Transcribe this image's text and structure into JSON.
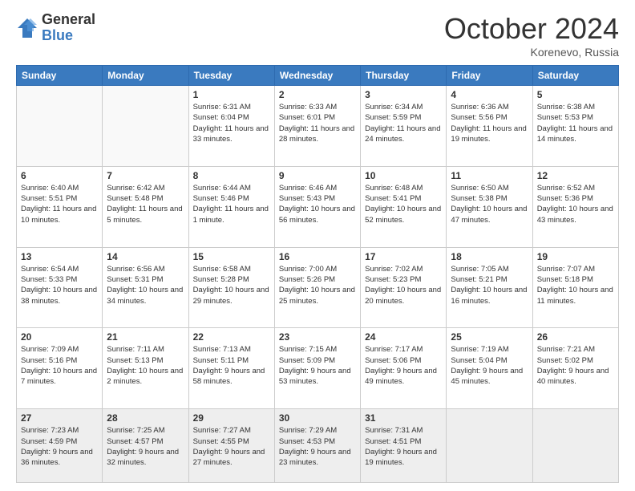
{
  "logo": {
    "general": "General",
    "blue": "Blue"
  },
  "header": {
    "month": "October 2024",
    "location": "Korenevo, Russia"
  },
  "days_of_week": [
    "Sunday",
    "Monday",
    "Tuesday",
    "Wednesday",
    "Thursday",
    "Friday",
    "Saturday"
  ],
  "weeks": [
    [
      {
        "day": "",
        "info": ""
      },
      {
        "day": "",
        "info": ""
      },
      {
        "day": "1",
        "info": "Sunrise: 6:31 AM\nSunset: 6:04 PM\nDaylight: 11 hours and 33 minutes."
      },
      {
        "day": "2",
        "info": "Sunrise: 6:33 AM\nSunset: 6:01 PM\nDaylight: 11 hours and 28 minutes."
      },
      {
        "day": "3",
        "info": "Sunrise: 6:34 AM\nSunset: 5:59 PM\nDaylight: 11 hours and 24 minutes."
      },
      {
        "day": "4",
        "info": "Sunrise: 6:36 AM\nSunset: 5:56 PM\nDaylight: 11 hours and 19 minutes."
      },
      {
        "day": "5",
        "info": "Sunrise: 6:38 AM\nSunset: 5:53 PM\nDaylight: 11 hours and 14 minutes."
      }
    ],
    [
      {
        "day": "6",
        "info": "Sunrise: 6:40 AM\nSunset: 5:51 PM\nDaylight: 11 hours and 10 minutes."
      },
      {
        "day": "7",
        "info": "Sunrise: 6:42 AM\nSunset: 5:48 PM\nDaylight: 11 hours and 5 minutes."
      },
      {
        "day": "8",
        "info": "Sunrise: 6:44 AM\nSunset: 5:46 PM\nDaylight: 11 hours and 1 minute."
      },
      {
        "day": "9",
        "info": "Sunrise: 6:46 AM\nSunset: 5:43 PM\nDaylight: 10 hours and 56 minutes."
      },
      {
        "day": "10",
        "info": "Sunrise: 6:48 AM\nSunset: 5:41 PM\nDaylight: 10 hours and 52 minutes."
      },
      {
        "day": "11",
        "info": "Sunrise: 6:50 AM\nSunset: 5:38 PM\nDaylight: 10 hours and 47 minutes."
      },
      {
        "day": "12",
        "info": "Sunrise: 6:52 AM\nSunset: 5:36 PM\nDaylight: 10 hours and 43 minutes."
      }
    ],
    [
      {
        "day": "13",
        "info": "Sunrise: 6:54 AM\nSunset: 5:33 PM\nDaylight: 10 hours and 38 minutes."
      },
      {
        "day": "14",
        "info": "Sunrise: 6:56 AM\nSunset: 5:31 PM\nDaylight: 10 hours and 34 minutes."
      },
      {
        "day": "15",
        "info": "Sunrise: 6:58 AM\nSunset: 5:28 PM\nDaylight: 10 hours and 29 minutes."
      },
      {
        "day": "16",
        "info": "Sunrise: 7:00 AM\nSunset: 5:26 PM\nDaylight: 10 hours and 25 minutes."
      },
      {
        "day": "17",
        "info": "Sunrise: 7:02 AM\nSunset: 5:23 PM\nDaylight: 10 hours and 20 minutes."
      },
      {
        "day": "18",
        "info": "Sunrise: 7:05 AM\nSunset: 5:21 PM\nDaylight: 10 hours and 16 minutes."
      },
      {
        "day": "19",
        "info": "Sunrise: 7:07 AM\nSunset: 5:18 PM\nDaylight: 10 hours and 11 minutes."
      }
    ],
    [
      {
        "day": "20",
        "info": "Sunrise: 7:09 AM\nSunset: 5:16 PM\nDaylight: 10 hours and 7 minutes."
      },
      {
        "day": "21",
        "info": "Sunrise: 7:11 AM\nSunset: 5:13 PM\nDaylight: 10 hours and 2 minutes."
      },
      {
        "day": "22",
        "info": "Sunrise: 7:13 AM\nSunset: 5:11 PM\nDaylight: 9 hours and 58 minutes."
      },
      {
        "day": "23",
        "info": "Sunrise: 7:15 AM\nSunset: 5:09 PM\nDaylight: 9 hours and 53 minutes."
      },
      {
        "day": "24",
        "info": "Sunrise: 7:17 AM\nSunset: 5:06 PM\nDaylight: 9 hours and 49 minutes."
      },
      {
        "day": "25",
        "info": "Sunrise: 7:19 AM\nSunset: 5:04 PM\nDaylight: 9 hours and 45 minutes."
      },
      {
        "day": "26",
        "info": "Sunrise: 7:21 AM\nSunset: 5:02 PM\nDaylight: 9 hours and 40 minutes."
      }
    ],
    [
      {
        "day": "27",
        "info": "Sunrise: 7:23 AM\nSunset: 4:59 PM\nDaylight: 9 hours and 36 minutes."
      },
      {
        "day": "28",
        "info": "Sunrise: 7:25 AM\nSunset: 4:57 PM\nDaylight: 9 hours and 32 minutes."
      },
      {
        "day": "29",
        "info": "Sunrise: 7:27 AM\nSunset: 4:55 PM\nDaylight: 9 hours and 27 minutes."
      },
      {
        "day": "30",
        "info": "Sunrise: 7:29 AM\nSunset: 4:53 PM\nDaylight: 9 hours and 23 minutes."
      },
      {
        "day": "31",
        "info": "Sunrise: 7:31 AM\nSunset: 4:51 PM\nDaylight: 9 hours and 19 minutes."
      },
      {
        "day": "",
        "info": ""
      },
      {
        "day": "",
        "info": ""
      }
    ]
  ]
}
